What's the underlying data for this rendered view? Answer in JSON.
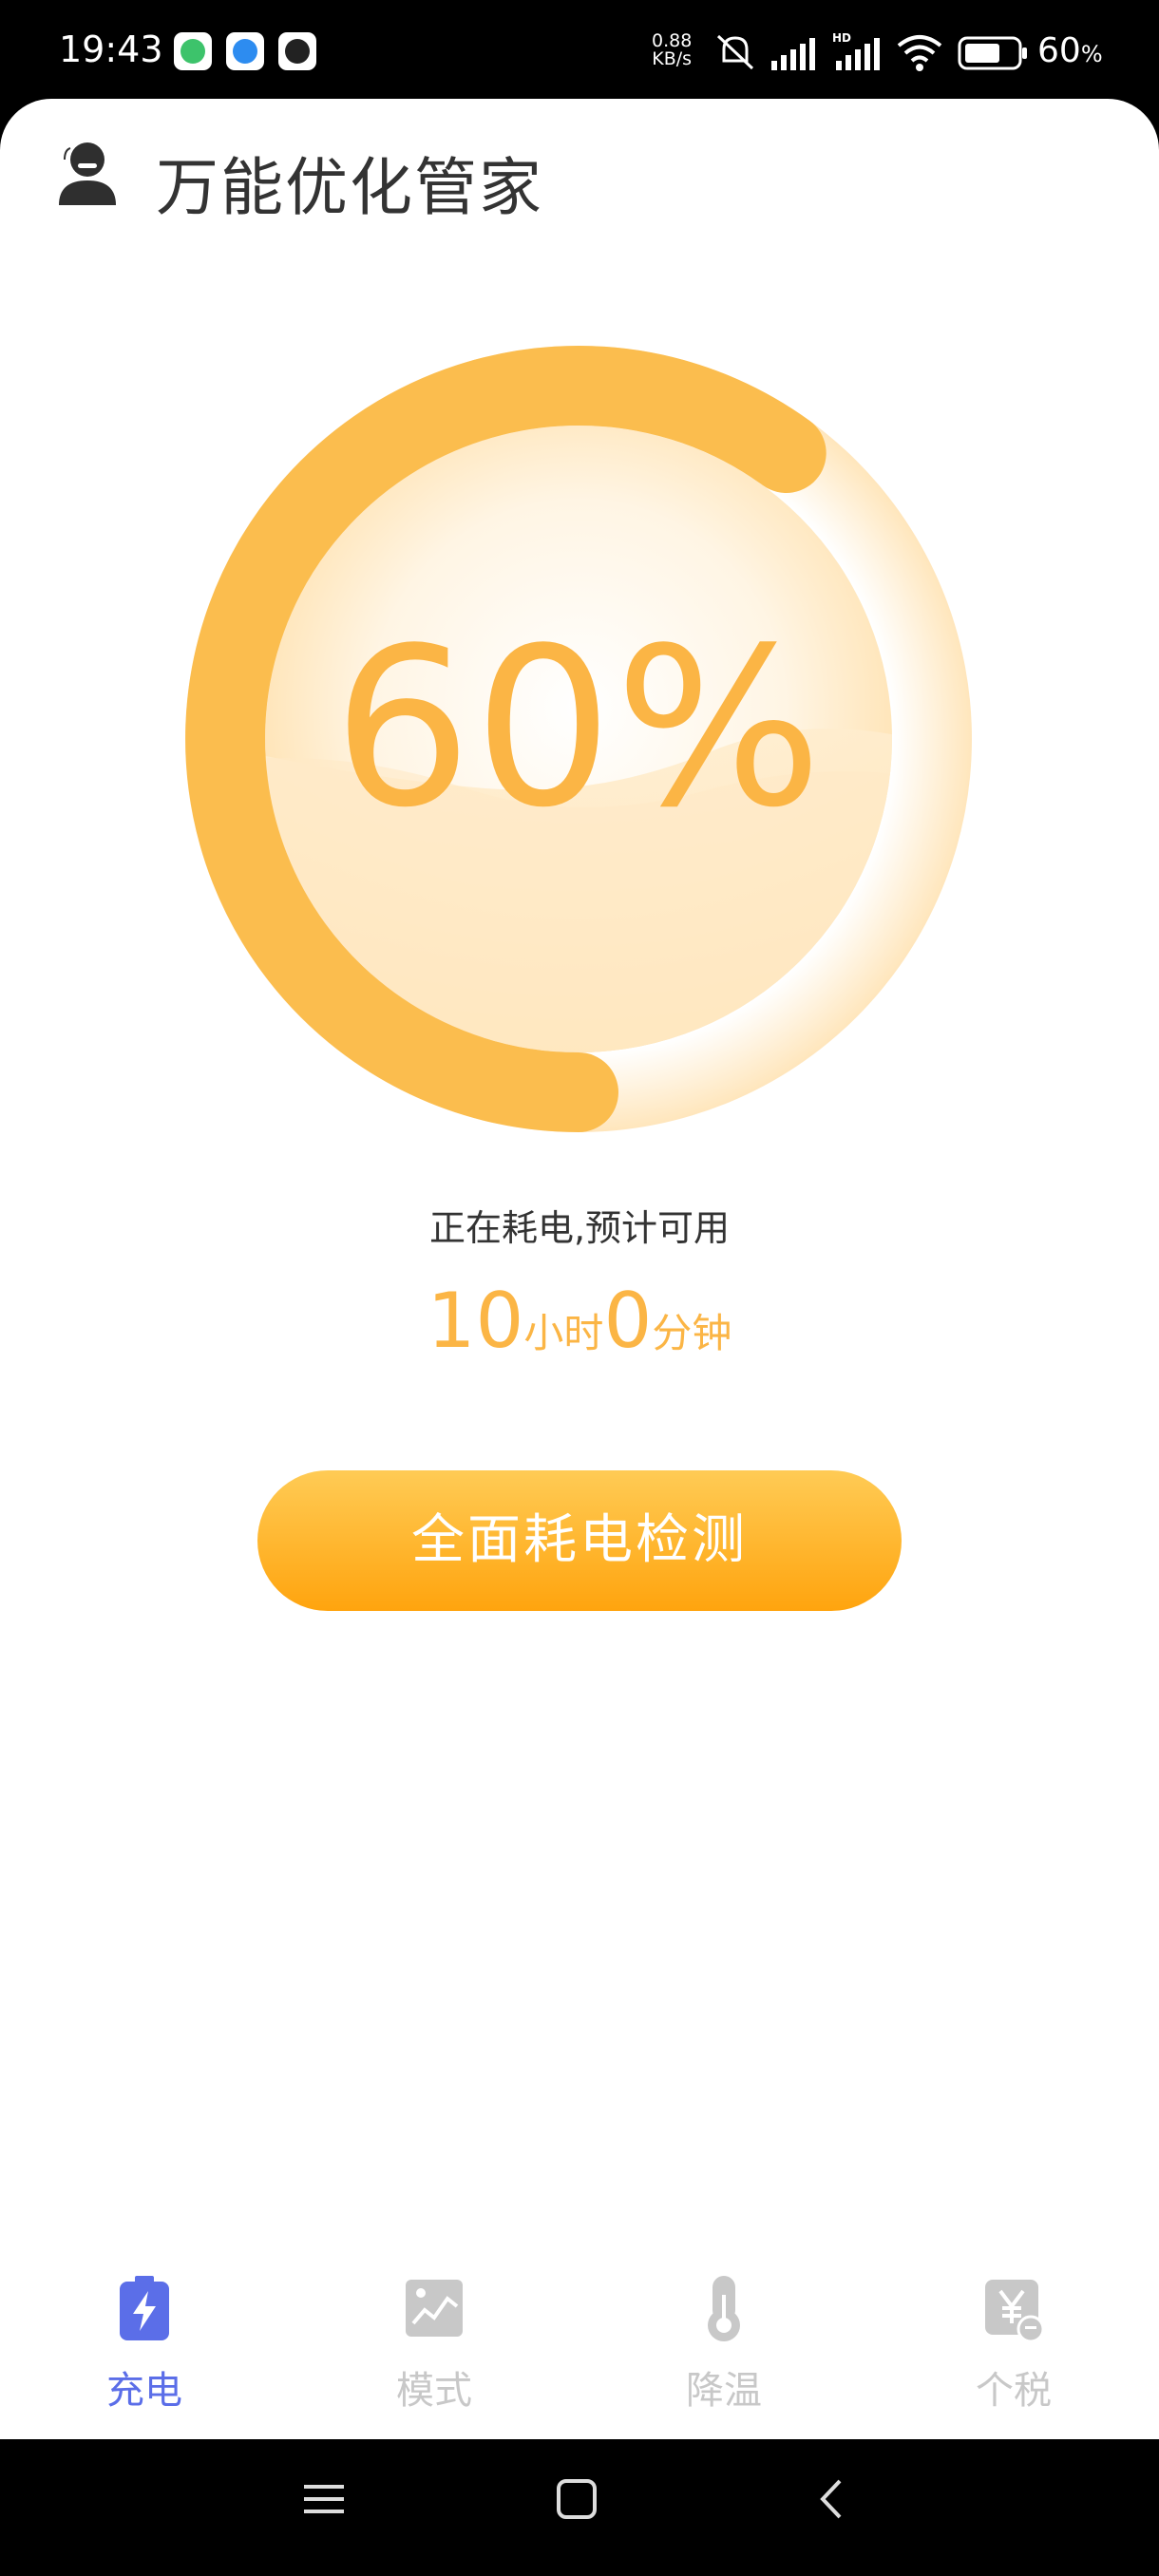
{
  "status_bar": {
    "time": "19:43",
    "net_speed_value": "0.88",
    "net_speed_unit": "KB/s",
    "battery_percent": "60",
    "battery_suffix": "%",
    "icons": [
      "wechat-like-app-icon",
      "browser-app-icon",
      "qq-app-icon",
      "mute-icon",
      "signal-icon",
      "hd-signal-icon",
      "wifi-icon",
      "battery-icon"
    ]
  },
  "header": {
    "title": "万能优化管家",
    "user_icon": "user-icon"
  },
  "gauge": {
    "value_text": "60%",
    "percent": 60,
    "accent": "#FBB545"
  },
  "status": {
    "line": "正在耗电,预计可用",
    "hours": "10",
    "hours_unit": "小时",
    "minutes": "0",
    "minutes_unit": "分钟"
  },
  "action": {
    "check_label": "全面耗电检测"
  },
  "nav": {
    "active_color": "#5B6EE8",
    "inactive_color": "#C8C8C8",
    "items": [
      {
        "label": "充电",
        "icon": "battery-charge-icon",
        "active": true
      },
      {
        "label": "模式",
        "icon": "chart-image-icon",
        "active": false
      },
      {
        "label": "降温",
        "icon": "thermometer-icon",
        "active": false
      },
      {
        "label": "个税",
        "icon": "yen-tax-icon",
        "active": false
      }
    ]
  },
  "system_nav": {
    "icons": [
      "menu-icon",
      "home-icon",
      "back-icon"
    ]
  }
}
